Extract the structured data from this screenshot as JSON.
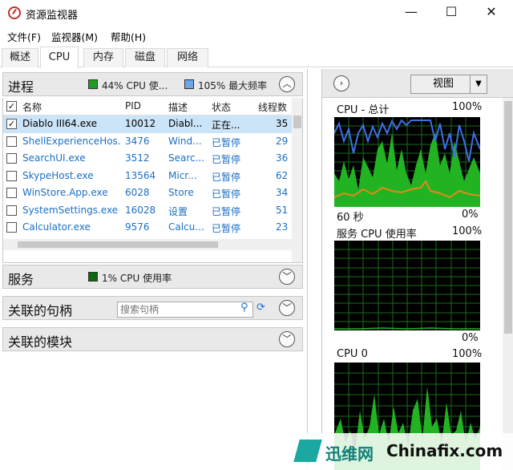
{
  "window": {
    "title": "资源监视器",
    "minimize": "—",
    "maximize": "☐",
    "close": "✕"
  },
  "menu": [
    "文件(F)",
    "监视器(M)",
    "帮助(H)"
  ],
  "tabs": [
    "概述",
    "CPU",
    "内存",
    "磁盘",
    "网络"
  ],
  "active_tab": "CPU",
  "process_section": {
    "title": "进程",
    "cpu_usage_text": "44% CPU 使...",
    "cpu_color": "#1f9d1f",
    "freq_text": "105% 最大频率",
    "freq_color": "#6aa7e4"
  },
  "process_table": {
    "headers": [
      "名称",
      "PID",
      "描述",
      "状态",
      "线程数"
    ],
    "rows": [
      {
        "checked": true,
        "name": "Diablo III64.exe",
        "pid": "10012",
        "desc": "Diabl...",
        "status": "正在...",
        "threads": "35",
        "selected": true
      },
      {
        "checked": false,
        "name": "ShellExperienceHos...",
        "pid": "3476",
        "desc": "Wind...",
        "status": "已暂停",
        "threads": "29"
      },
      {
        "checked": false,
        "name": "SearchUI.exe",
        "pid": "3512",
        "desc": "Searc...",
        "status": "已暂停",
        "threads": "36"
      },
      {
        "checked": false,
        "name": "SkypeHost.exe",
        "pid": "13564",
        "desc": "Micr...",
        "status": "已暂停",
        "threads": "62"
      },
      {
        "checked": false,
        "name": "WinStore.App.exe",
        "pid": "6028",
        "desc": "Store",
        "status": "已暂停",
        "threads": "34"
      },
      {
        "checked": false,
        "name": "SystemSettings.exe",
        "pid": "16028",
        "desc": "设置",
        "status": "已暂停",
        "threads": "51"
      },
      {
        "checked": false,
        "name": "Calculator.exe",
        "pid": "9576",
        "desc": "Calcu...",
        "status": "已暂停",
        "threads": "23"
      }
    ]
  },
  "services_section": {
    "title": "服务",
    "legend": "1% CPU 使用率",
    "color": "#0b6b0b"
  },
  "handles_section": {
    "title": "关联的句柄",
    "search_placeholder": "搜索句柄"
  },
  "modules_section": {
    "title": "关联的模块"
  },
  "right_pane": {
    "view_button": "视图",
    "graphs": [
      {
        "title": "CPU - 总计",
        "max": "100%",
        "time": "60 秒",
        "min": "0%"
      },
      {
        "title": "服务 CPU 使用率",
        "max": "100%",
        "min": "0%"
      },
      {
        "title": "CPU 0",
        "max": "100%"
      }
    ]
  },
  "watermark": {
    "brand_cn": "迅维网",
    "brand_en": "Chinafix.com"
  }
}
